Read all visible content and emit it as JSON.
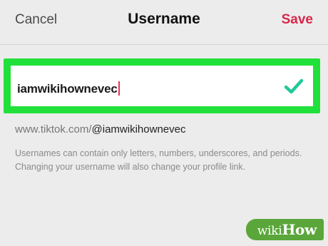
{
  "header": {
    "cancel_label": "Cancel",
    "title": "Username",
    "save_label": "Save"
  },
  "username_field": {
    "value": "iamwikihownevec",
    "status_icon": "check-icon"
  },
  "profile_link": {
    "base_url": "www.tiktok.com/",
    "handle": "@iamwikihownevec"
  },
  "help_text": "Usernames can contain only letters, numbers, underscores, and periods. Changing your username will also change your profile link.",
  "watermark": {
    "part1": "wiki",
    "part2": "How"
  },
  "colors": {
    "save": "#d7274a",
    "check": "#20c997",
    "highlight": "#22e03a",
    "watermark": "#5aa63a"
  }
}
